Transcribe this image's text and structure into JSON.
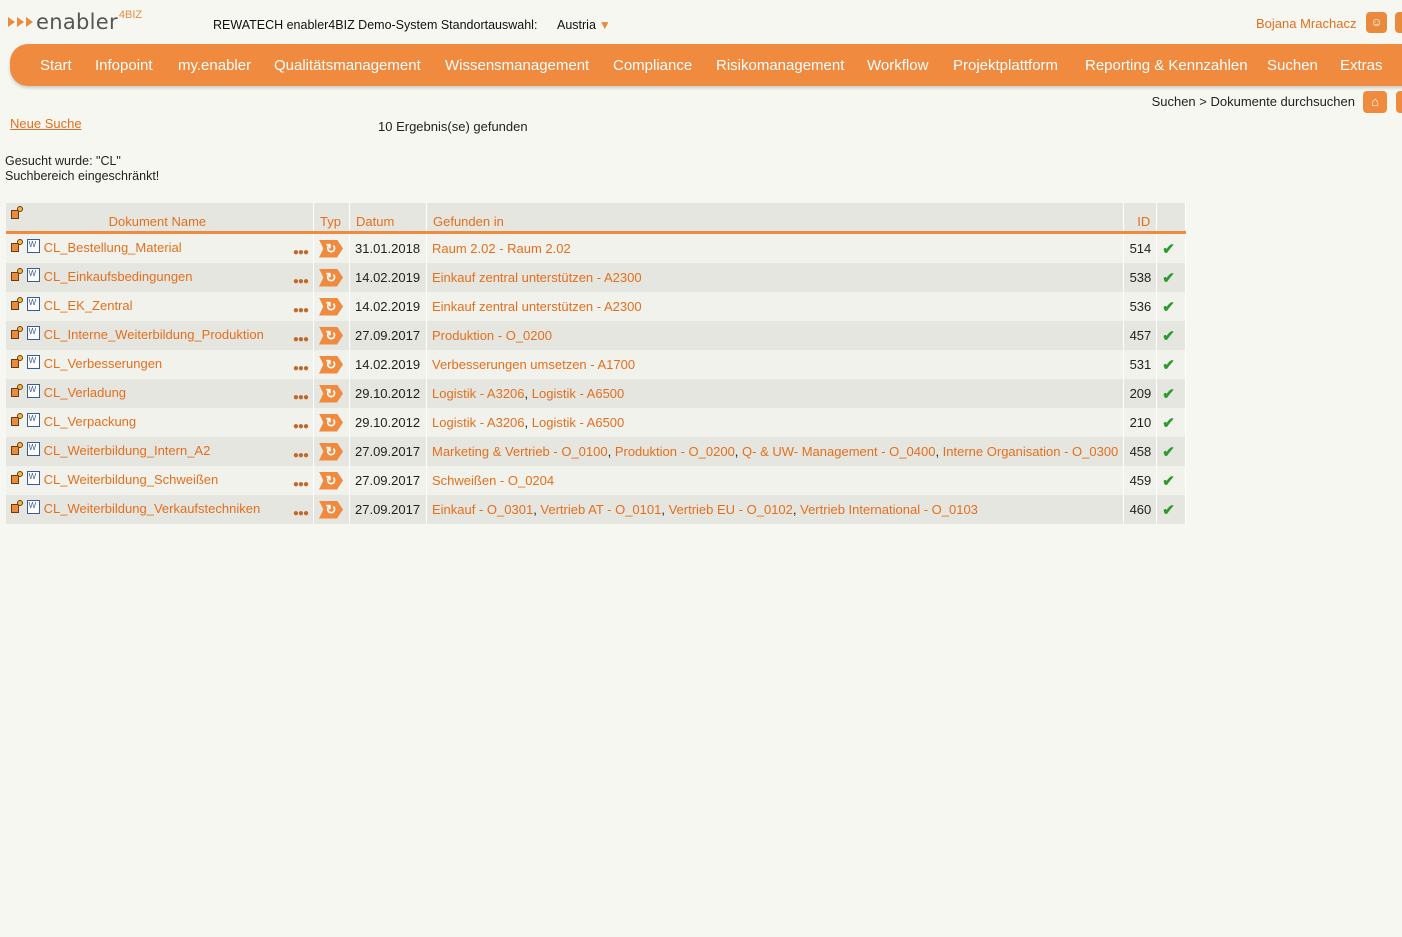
{
  "header": {
    "logo_text": "enabler",
    "logo_sup": "4BIZ",
    "system_name": "REWATECH enabler4BIZ Demo-System Standortauswahl:",
    "location": "Austria",
    "location_caret": "▼",
    "user_name": "Bojana Mrachacz"
  },
  "nav": {
    "items": [
      "Start",
      "Infopoint",
      "my.enabler",
      "Qualitätsmanagement",
      "Wissensmanagement",
      "Compliance",
      "Risikomanagement",
      "Workflow",
      "Projektplattform",
      "Reporting & Kennzahlen",
      "Suchen",
      "Extras"
    ]
  },
  "breadcrumb": "Suchen > Dokumente durchsuchen",
  "search": {
    "new_search": "Neue Suche",
    "result_count": "10 Ergebnis(se) gefunden",
    "searched_for": "Gesucht wurde: \"CL\"",
    "restricted": "Suchbereich eingeschränkt!"
  },
  "table": {
    "headers": {
      "name": "Dokument Name",
      "type": "Typ",
      "date": "Datum",
      "found_in": "Gefunden in",
      "id": "ID"
    },
    "rows": [
      {
        "name": "CL_Bestellung_Material",
        "date": "31.01.2018",
        "found_in": [
          "Raum 2.02 - Raum 2.02"
        ],
        "id": "514"
      },
      {
        "name": "CL_Einkaufsbedingungen",
        "date": "14.02.2019",
        "found_in": [
          "Einkauf zentral unterstützen - A2300"
        ],
        "id": "538"
      },
      {
        "name": "CL_EK_Zentral",
        "date": "14.02.2019",
        "found_in": [
          "Einkauf zentral unterstützen - A2300"
        ],
        "id": "536"
      },
      {
        "name": "CL_Interne_Weiterbildung_Produktion",
        "date": "27.09.2017",
        "found_in": [
          "Produktion - O_0200"
        ],
        "id": "457"
      },
      {
        "name": "CL_Verbesserungen",
        "date": "14.02.2019",
        "found_in": [
          "Verbesserungen umsetzen - A1700"
        ],
        "id": "531"
      },
      {
        "name": "CL_Verladung",
        "date": "29.10.2012",
        "found_in": [
          "Logistik - A3206",
          "Logistik - A6500"
        ],
        "id": "209"
      },
      {
        "name": "CL_Verpackung",
        "date": "29.10.2012",
        "found_in": [
          "Logistik - A3206",
          "Logistik - A6500"
        ],
        "id": "210"
      },
      {
        "name": "CL_Weiterbildung_Intern_A2",
        "date": "27.09.2017",
        "found_in": [
          "Marketing & Vertrieb - O_0100",
          "Produktion - O_0200",
          "Q- & UW- Management - O_0400",
          "Interne Organisation - O_0300"
        ],
        "id": "458"
      },
      {
        "name": "CL_Weiterbildung_Schweißen",
        "date": "27.09.2017",
        "found_in": [
          "Schweißen - O_0204"
        ],
        "id": "459"
      },
      {
        "name": "CL_Weiterbildung_Verkaufstechniken",
        "date": "27.09.2017",
        "found_in": [
          "Einkauf - O_0301",
          "Vertrieb AT - O_0101",
          "Vertrieb EU - O_0102",
          "Vertrieb International - O_0103"
        ],
        "id": "460"
      }
    ]
  },
  "icons": {
    "edit": "edit-icon",
    "doc": "word-document-icon",
    "more": "more-options-icon",
    "type": "workflow-type-icon",
    "status": "checkmark-icon",
    "home": "home-icon",
    "user": "user-icon"
  },
  "colors": {
    "accent": "#ef8a3f",
    "link": "#e36f1e",
    "check": "#2e9a2e"
  }
}
